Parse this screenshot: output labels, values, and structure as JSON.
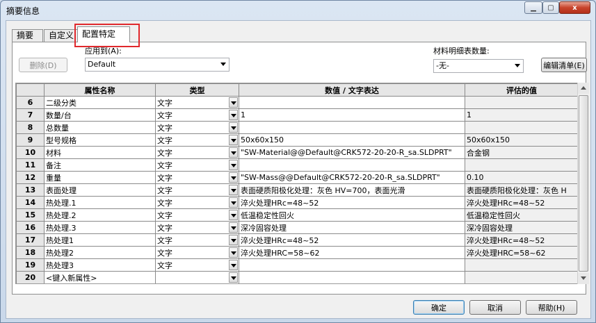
{
  "window": {
    "title": "摘要信息"
  },
  "titlebar": {
    "min_icon": "minimize-icon",
    "max_icon": "maximize-icon",
    "close_icon": "close-icon",
    "close_glyph": "x"
  },
  "tabs": [
    {
      "label": "摘要"
    },
    {
      "label": "自定义"
    },
    {
      "label": "配置特定",
      "active": true
    }
  ],
  "toolbar": {
    "delete_label": "删除(D)",
    "apply_to_label": "应用到(A):",
    "apply_to_value": "Default",
    "bom_qty_label": "材料明细表数量:",
    "bom_qty_value": "-无-",
    "edit_list_label": "编辑清单(E)"
  },
  "table": {
    "headers": [
      "属性名称",
      "类型",
      "数值 / 文字表达",
      "评估的值"
    ],
    "rows": [
      {
        "num": "6",
        "name": "二级分类",
        "type": "文字",
        "value": "",
        "evaluated": ""
      },
      {
        "num": "7",
        "name": "数量/台",
        "type": "文字",
        "value": "1",
        "evaluated": "1"
      },
      {
        "num": "8",
        "name": "总数量",
        "type": "文字",
        "value": "",
        "evaluated": ""
      },
      {
        "num": "9",
        "name": "型号规格",
        "type": "文字",
        "value": "50x60x150",
        "evaluated": "50x60x150"
      },
      {
        "num": "10",
        "name": "材料",
        "type": "文字",
        "value": "\"SW-Material@@Default@CRK572-20-20-R_sa.SLDPRT\"",
        "evaluated": "合金钢"
      },
      {
        "num": "11",
        "name": "备注",
        "type": "文字",
        "value": "",
        "evaluated": ""
      },
      {
        "num": "12",
        "name": "重量",
        "type": "文字",
        "value": "\"SW-Mass@@Default@CRK572-20-20-R_sa.SLDPRT\"",
        "evaluated": "0.10"
      },
      {
        "num": "13",
        "name": "表面处理",
        "type": "文字",
        "value": "表面硬质阳极化处理：灰色 HV=700，表面光滑",
        "evaluated": "表面硬质阳极化处理：灰色 H"
      },
      {
        "num": "14",
        "name": "热处理.1",
        "type": "文字",
        "value": "淬火处理HRc=48~52",
        "evaluated": "淬火处理HRc=48~52"
      },
      {
        "num": "15",
        "name": "热处理.2",
        "type": "文字",
        "value": "低温稳定性回火",
        "evaluated": "低温稳定性回火"
      },
      {
        "num": "16",
        "name": "热处理.3",
        "type": "文字",
        "value": "深冷固容处理",
        "evaluated": "深冷固容处理"
      },
      {
        "num": "17",
        "name": "热处理1",
        "type": "文字",
        "value": "淬火处理HRc=48~52",
        "evaluated": "淬火处理HRc=48~52"
      },
      {
        "num": "18",
        "name": "热处理2",
        "type": "文字",
        "value": "淬火处理HRC=58~62",
        "evaluated": "淬火处理HRC=58~62"
      },
      {
        "num": "19",
        "name": "热处理3",
        "type": "文字",
        "value": "",
        "evaluated": ""
      },
      {
        "num": "20",
        "name": "<键入新属性>",
        "type": "",
        "value": "",
        "evaluated": ""
      }
    ]
  },
  "footer": {
    "ok_label": "确定",
    "cancel_label": "取消",
    "help_label": "帮助(H)"
  },
  "colors": {
    "tab_highlight": "#e0282c",
    "close_button": "#c8442c"
  }
}
